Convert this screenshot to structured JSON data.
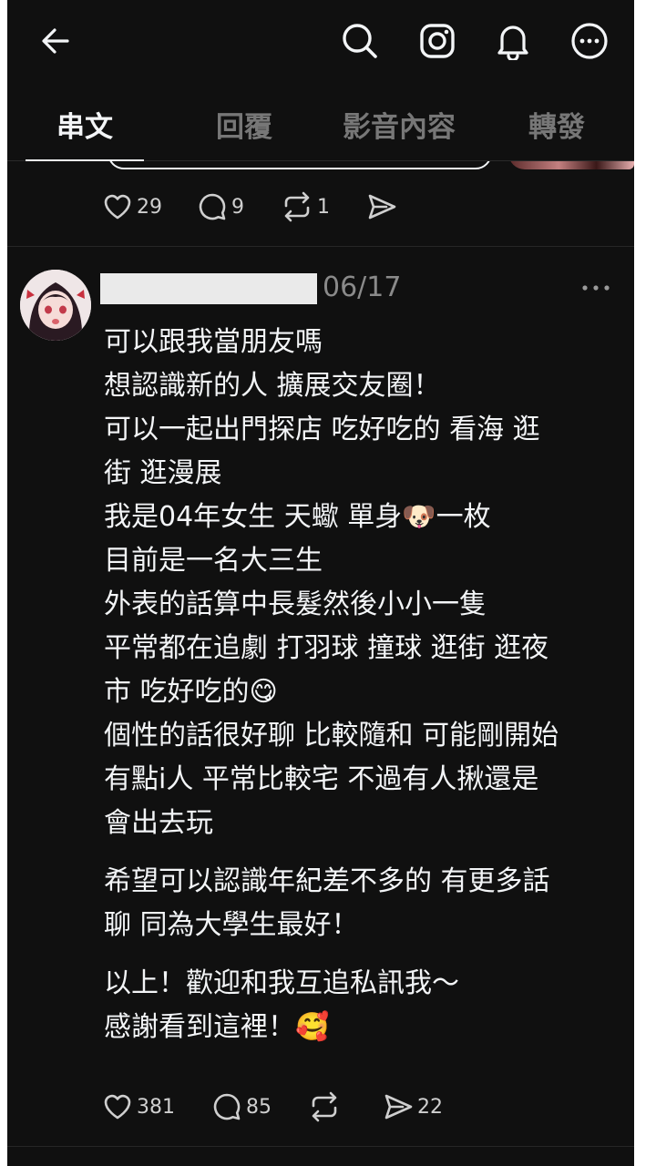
{
  "tabs": [
    {
      "label": "串文",
      "active": true
    },
    {
      "label": "回覆",
      "active": false
    },
    {
      "label": "影音內容",
      "active": false
    },
    {
      "label": "轉發",
      "active": false
    }
  ],
  "prev_post": {
    "likes": "29",
    "comments": "9",
    "reposts": "1"
  },
  "post": {
    "date": "06/17",
    "paragraphs": [
      [
        "可以跟我當朋友嗎",
        "想認識新的人 擴展交友圈！",
        "可以一起出門探店 吃好吃的 看海 逛",
        "街 逛漫展",
        "我是04年女生 天蠍 單身🐶一枚",
        "目前是一名大三生",
        "外表的話算中長髮然後小小一隻",
        "平常都在追劇 打羽球 撞球 逛街 逛夜",
        "市 吃好吃的😋",
        "個性的話很好聊 比較隨和 可能剛開始",
        "有點i人 平常比較宅 不過有人揪還是",
        "會出去玩"
      ],
      [
        "希望可以認識年紀差不多的 有更多話",
        "聊 同為大學生最好！"
      ],
      [
        "以上！歡迎和我互追私訊我～",
        "感謝看到這裡！🥰"
      ]
    ],
    "likes": "381",
    "comments": "85",
    "shares": "22"
  },
  "icons": {
    "back": "arrow-left-icon",
    "search": "search-icon",
    "instagram": "instagram-icon",
    "notifications": "bell-icon",
    "more": "more-circle-icon"
  },
  "colors": {
    "background": "#101010",
    "text": "#f3f5f7",
    "muted": "#777777",
    "redaction": "#eaeaea"
  }
}
